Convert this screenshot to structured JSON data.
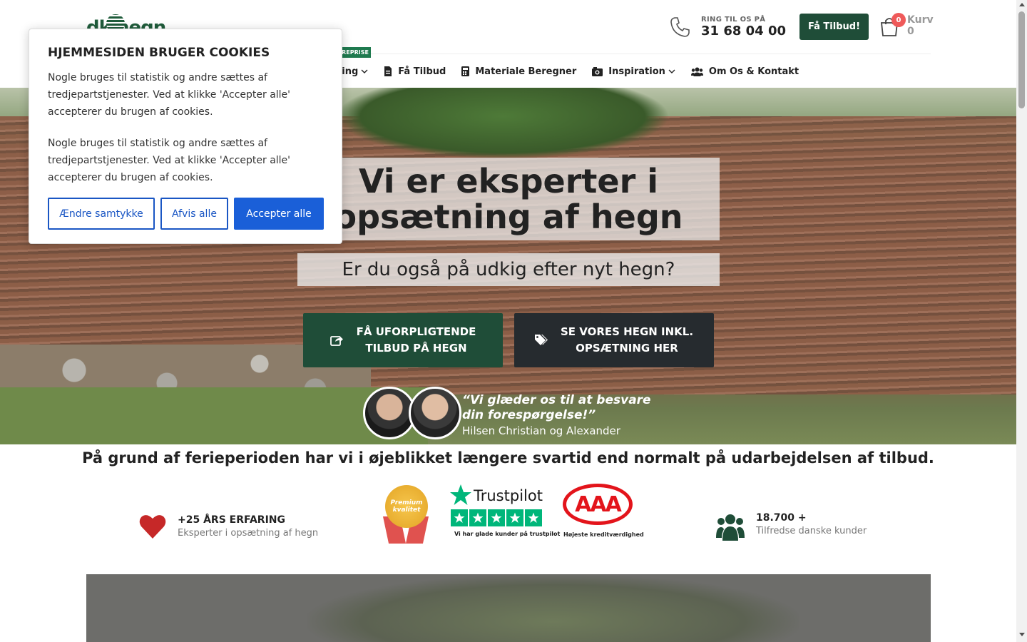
{
  "header": {
    "logo_text": "dk hegn",
    "phone_kicker": "RING TIL OS PÅ",
    "phone_number": "31 68 04 00",
    "cta_label": "Få Tilbud!",
    "cart": {
      "label": "Kurv",
      "count": "0",
      "total": "0"
    },
    "entreprise_badge": "TREPRISE"
  },
  "nav": {
    "items": [
      {
        "label": "ning",
        "icon": "partial-dropdown",
        "has_dropdown": true
      },
      {
        "label": "Få Tilbud",
        "icon": "file-icon",
        "has_dropdown": false
      },
      {
        "label": "Materiale Beregner",
        "icon": "calculator-icon",
        "has_dropdown": false
      },
      {
        "label": "Inspiration",
        "icon": "camera-icon",
        "has_dropdown": true
      },
      {
        "label": "Om Os & Kontakt",
        "icon": "users-icon",
        "has_dropdown": false
      }
    ]
  },
  "hero": {
    "title": "Vi er eksperter i\nopsætning af hegn",
    "subtitle": "Er du også på udkig efter nyt hegn? ",
    "btn_quote": "FÅ UFORPLIGTENDE\nTILBUD PÅ HEGN",
    "btn_fences": "SE VORES HEGN INKL.\nOPSÆTNING HER",
    "quote": "“Vi glæder os til at besvare\ndin forespørgelse!”",
    "signature": "Hilsen Christian og Alexander"
  },
  "notice": " På grund af ferieperioden har vi i øjeblikket længere svartid end normalt på udarbejdelsen af tilbud.",
  "trust": {
    "experience_title": "+25 ÅRS ERFARING",
    "experience_text": "Eksperter i opsætning af hegn",
    "medal_text": "Premium\nkvalitet",
    "trustpilot_name": "Trustpilot",
    "trustpilot_caption": "Vi har glade kunder på trustpilot",
    "aaa_text": "AAA",
    "aaa_caption": "Højeste kreditværdighed",
    "customers_title": "18.700 +",
    "customers_text": "Tilfredse danske kunder"
  },
  "cookie": {
    "title": "HJEMMESIDEN BRUGER COOKIES",
    "paragraph1": "Nogle bruges til statistik og andre sættes af tredjepartstjenester. Ved at klikke 'Accepter alle' accepterer du brugen af cookies.",
    "paragraph2": "Nogle bruges til statistik og andre sættes af tredjepartstjenester. Ved at klikke 'Accepter alle' accepterer du brugen af cookies.",
    "btn_change": "Ændre samtykke",
    "btn_reject": "Afvis alle",
    "btn_accept": "Accepter alle"
  },
  "colors": {
    "brand_green": "#1f4d38",
    "accept_blue": "#1a5fd8",
    "badge_red": "#ef5a5a",
    "trustpilot_green": "#00b67a",
    "aaa_red": "#e3141b"
  }
}
